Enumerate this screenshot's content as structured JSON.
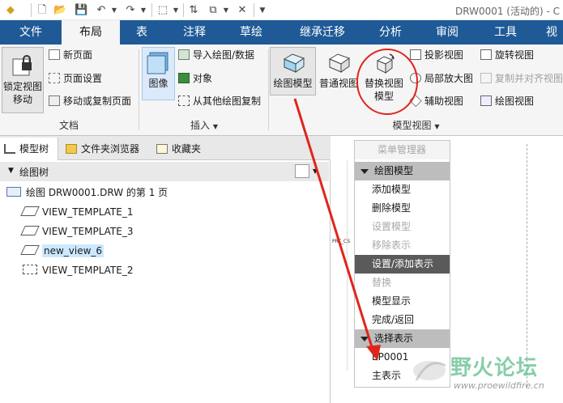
{
  "window": {
    "title": "DRW0001 (活动的) - C"
  },
  "tabs": [
    {
      "label": "文件"
    },
    {
      "label": "布局"
    },
    {
      "label": "表"
    },
    {
      "label": "注释"
    },
    {
      "label": "草绘"
    },
    {
      "label": "继承迁移"
    },
    {
      "label": "分析"
    },
    {
      "label": "审阅"
    },
    {
      "label": "工具"
    },
    {
      "label": "视"
    }
  ],
  "ribbon": {
    "document": {
      "group_label": "文档",
      "lock_view_move": "锁定视图\n移动",
      "new_page": "新页面",
      "page_setup": "页面设置",
      "move_copy_page": "移动或复制页面"
    },
    "insert": {
      "group_label": "插入",
      "image": "图像",
      "import_drawing": "导入绘图/数据",
      "object": "对象",
      "copy_from_drawing": "从其他绘图复制"
    },
    "model_views": {
      "group_label": "模型视图",
      "drawing_model": "绘图模型",
      "general_view": "普通视图",
      "replace_view_model": "替换视图\n模型",
      "projection_view": "投影视图",
      "detailed_view": "局部放大图",
      "auxiliary_view": "辅助视图",
      "revolved_view": "旋转视图",
      "copy_align_view": "复制并对齐视图",
      "drawing_view": "绘图视图"
    }
  },
  "panel": {
    "tabs": [
      {
        "label": "模型树"
      },
      {
        "label": "文件夹浏览器"
      },
      {
        "label": "收藏夹"
      }
    ],
    "tree_header": "绘图树",
    "tree_items": [
      {
        "label": "绘图 DRW0001.DRW 的第 1 页"
      },
      {
        "label": "VIEW_TEMPLATE_1"
      },
      {
        "label": "VIEW_TEMPLATE_3"
      },
      {
        "label": "new_view_6"
      },
      {
        "label": "VIEW_TEMPLATE_2"
      }
    ]
  },
  "canvas": {
    "label": "PRT_CS"
  },
  "menu_manager": {
    "title": "菜单管理器",
    "section1_header": "绘图模型",
    "items1": [
      {
        "label": "添加模型",
        "enabled": true
      },
      {
        "label": "删除模型",
        "enabled": true
      },
      {
        "label": "设置模型",
        "enabled": false
      },
      {
        "label": "移除表示",
        "enabled": false
      },
      {
        "label": "设置/添加表示",
        "enabled": true,
        "highlighted": true
      },
      {
        "label": "替换",
        "enabled": false
      },
      {
        "label": "模型显示",
        "enabled": true
      },
      {
        "label": "完成/返回",
        "enabled": true
      }
    ],
    "section2_header": "选择表示",
    "items2": [
      {
        "label": "EP0001"
      },
      {
        "label": "主表示"
      }
    ]
  },
  "watermark": {
    "text": "野火论坛",
    "url": "www.proewildfire.cn"
  },
  "colors": {
    "tab_bar": "#1f5a97",
    "arrow": "#e0251b",
    "selection": "#cce8ff"
  }
}
